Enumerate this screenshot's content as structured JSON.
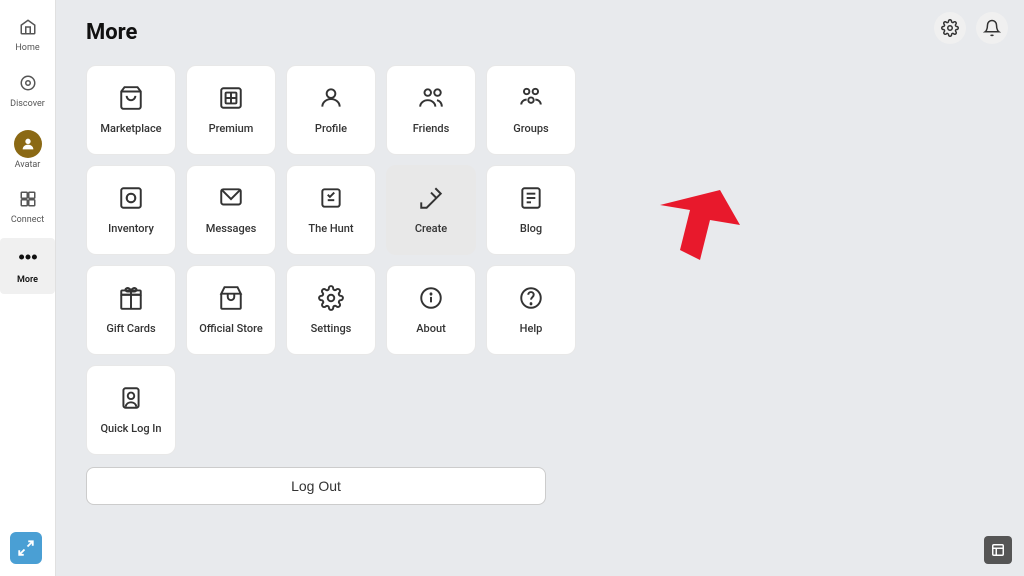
{
  "page": {
    "title": "More"
  },
  "sidebar": {
    "items": [
      {
        "id": "home",
        "label": "Home",
        "icon": "⌂"
      },
      {
        "id": "discover",
        "label": "Discover",
        "icon": "○"
      },
      {
        "id": "avatar",
        "label": "Avatar",
        "icon": "avatar"
      },
      {
        "id": "connect",
        "label": "Connect",
        "icon": "□"
      },
      {
        "id": "more",
        "label": "More",
        "icon": "•••",
        "active": true
      }
    ]
  },
  "topRight": {
    "settingsIcon": "⚙",
    "notificationIcon": "🔔"
  },
  "grid": {
    "items": [
      {
        "id": "marketplace",
        "label": "Marketplace",
        "icon": "🛍",
        "highlighted": false
      },
      {
        "id": "premium",
        "label": "Premium",
        "icon": "premium",
        "highlighted": false
      },
      {
        "id": "profile",
        "label": "Profile",
        "icon": "👤",
        "highlighted": false
      },
      {
        "id": "friends",
        "label": "Friends",
        "icon": "friends",
        "highlighted": false
      },
      {
        "id": "groups",
        "label": "Groups",
        "icon": "groups",
        "highlighted": false
      },
      {
        "id": "inventory",
        "label": "Inventory",
        "icon": "inventory",
        "highlighted": false
      },
      {
        "id": "messages",
        "label": "Messages",
        "icon": "messages",
        "highlighted": false
      },
      {
        "id": "the-hunt",
        "label": "The Hunt",
        "icon": "hunt",
        "highlighted": false
      },
      {
        "id": "create",
        "label": "Create",
        "icon": "create",
        "highlighted": true
      },
      {
        "id": "blog",
        "label": "Blog",
        "icon": "blog",
        "highlighted": false
      },
      {
        "id": "gift-cards",
        "label": "Gift Cards",
        "icon": "gift",
        "highlighted": false
      },
      {
        "id": "official-store",
        "label": "Official Store",
        "icon": "store",
        "highlighted": false
      },
      {
        "id": "settings",
        "label": "Settings",
        "icon": "⚙",
        "highlighted": false
      },
      {
        "id": "about",
        "label": "About",
        "icon": "about",
        "highlighted": false
      },
      {
        "id": "help",
        "label": "Help",
        "icon": "help",
        "highlighted": false
      },
      {
        "id": "quick-log-in",
        "label": "Quick Log In",
        "icon": "quicklogin",
        "highlighted": false
      }
    ]
  },
  "logoutBtn": {
    "label": "Log Out"
  }
}
